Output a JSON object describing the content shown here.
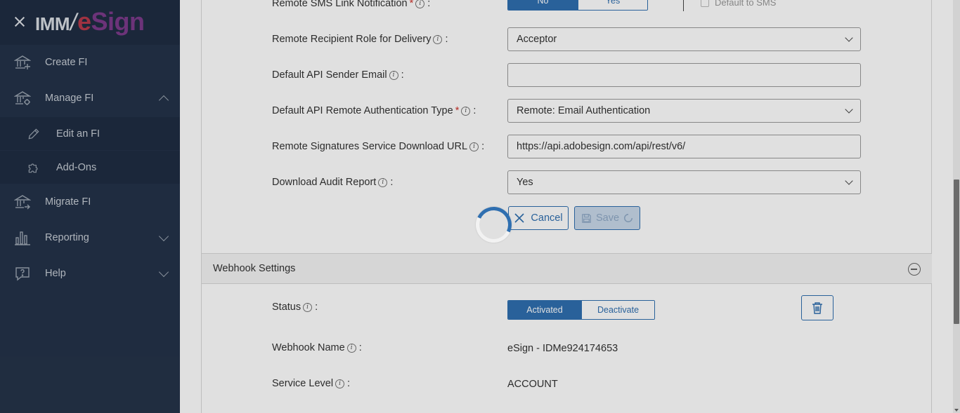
{
  "sidebar": {
    "logo": {
      "part_a": "IMM",
      "part_b_e": "e",
      "part_b_rest": "Sign"
    },
    "items": [
      {
        "label": "Create FI",
        "icon": "bank-plus-icon"
      },
      {
        "label": "Manage FI",
        "icon": "bank-gear-icon",
        "expanded": true
      },
      {
        "label": "Edit an FI",
        "icon": "pencil-icon",
        "sub": true
      },
      {
        "label": "Add-Ons",
        "icon": "puzzle-icon",
        "sub": true
      },
      {
        "label": "Migrate FI",
        "icon": "bank-arrow-icon"
      },
      {
        "label": "Reporting",
        "icon": "bar-chart-icon"
      },
      {
        "label": "Help",
        "icon": "help-bubble-icon"
      }
    ]
  },
  "form": {
    "sms_notification": {
      "label": "Remote SMS Link Notification",
      "options": [
        "No",
        "Yes"
      ],
      "selected": "No",
      "checkbox_label": "Default to SMS"
    },
    "recipient_role": {
      "label": "Remote Recipient Role for Delivery",
      "value": "Acceptor"
    },
    "api_sender_email": {
      "label": "Default API Sender Email",
      "value": ""
    },
    "auth_type": {
      "label": "Default API Remote Authentication Type",
      "value": "Remote: Email Authentication"
    },
    "download_url": {
      "label": "Remote Signatures Service Download URL",
      "value": "https://api.adobesign.com/api/rest/v6/"
    },
    "audit_report": {
      "label": "Download Audit Report",
      "value": "Yes"
    },
    "cancel_label": "Cancel",
    "save_label": "Save"
  },
  "webhook": {
    "section_title": "Webhook Settings",
    "status": {
      "label": "Status",
      "options": [
        "Activated",
        "Deactivate"
      ],
      "selected": "Activated"
    },
    "name": {
      "label": "Webhook Name",
      "value": "eSign - IDMe924174653"
    },
    "service_level": {
      "label": "Service Level",
      "value": "ACCOUNT"
    }
  },
  "colors": {
    "sidebar_bg": "#243349",
    "accent": "#2f6fb0",
    "logo_purple": "#7b3b8a",
    "logo_red": "#b53a4a"
  }
}
